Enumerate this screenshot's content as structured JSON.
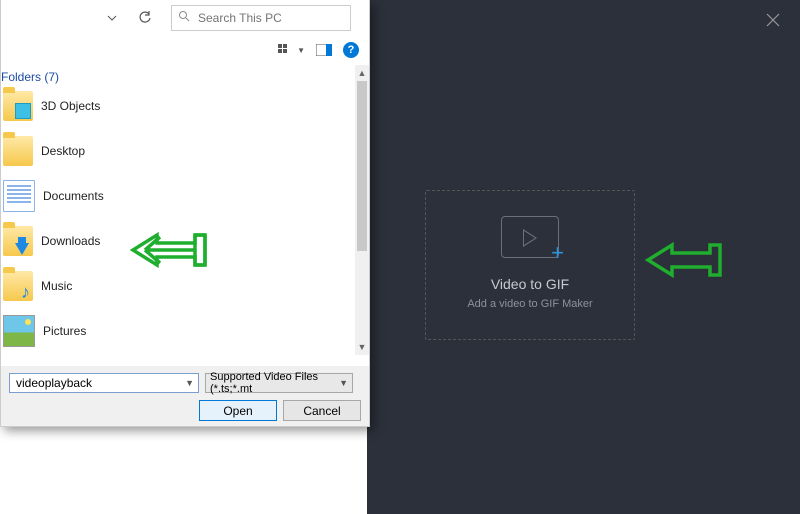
{
  "app": {
    "dropzone_title": "Video to GIF",
    "dropzone_sub": "Add a video to GIF Maker"
  },
  "dialog": {
    "search_placeholder": "Search This PC",
    "folders_header": "Folders (7)",
    "items": [
      {
        "label": "3D Objects"
      },
      {
        "label": "Desktop"
      },
      {
        "label": "Documents"
      },
      {
        "label": "Downloads"
      },
      {
        "label": "Music"
      },
      {
        "label": "Pictures"
      }
    ],
    "filename": "videoplayback",
    "filetype": "Supported Video Files (*.ts;*.mt",
    "open_label": "Open",
    "cancel_label": "Cancel"
  }
}
